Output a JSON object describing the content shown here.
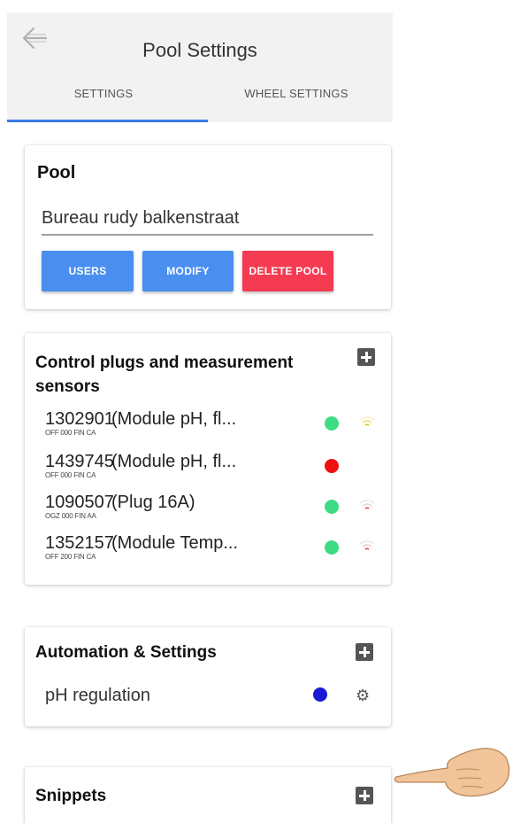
{
  "header": {
    "title": "Pool Settings",
    "back_icon": "back-arrow-icon"
  },
  "tabs": [
    {
      "label": "SETTINGS",
      "active": true
    },
    {
      "label": "WHEEL SETTINGS",
      "active": false
    }
  ],
  "pool_card": {
    "title": "Pool",
    "name_value": "Bureau rudy balkenstraat",
    "buttons": {
      "users": "USERS",
      "modify": "MODIFY",
      "delete": "DELETE POOL"
    }
  },
  "sensors_card": {
    "title": "Control plugs and measurement sensors",
    "items": [
      {
        "id": "1302901",
        "code": "OFF 000 FIN CA",
        "desc": "(Module pH, fl...",
        "status_color": "#3ddc84",
        "signal": "wifi-yellow"
      },
      {
        "id": "1439745",
        "code": "OFF 000 FIN CA",
        "desc": "(Module pH, fl...",
        "status_color": "#ee1111",
        "signal": "none"
      },
      {
        "id": "1090507",
        "code": "OGZ 000 FIN AA",
        "desc": "(Plug 16A)",
        "status_color": "#3ddc84",
        "signal": "wifi-red"
      },
      {
        "id": "1352157",
        "code": "OFF 200 FIN CA",
        "desc": "(Module Temp...",
        "status_color": "#3ddc84",
        "signal": "wifi-red"
      }
    ]
  },
  "automation_card": {
    "title": "Automation & Settings",
    "items": [
      {
        "label": "pH regulation",
        "status_color": "#1a1ad6",
        "icon": "gear-icon"
      }
    ]
  },
  "snippets_card": {
    "title": "Snippets"
  },
  "colors": {
    "accent": "#3b7be8",
    "button_blue": "#4a8ff0",
    "button_red": "#f53b52"
  }
}
